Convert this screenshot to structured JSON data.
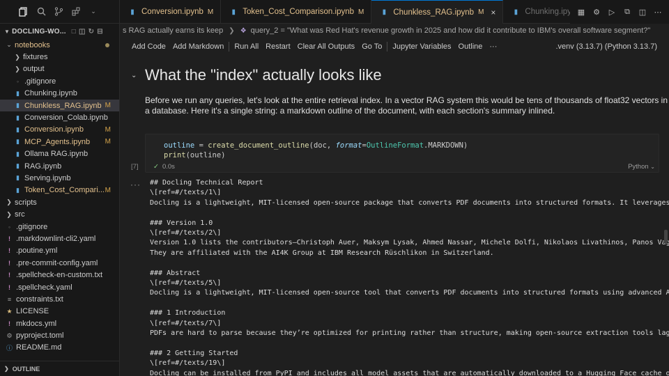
{
  "explorer": {
    "title": "DOCLING-WO...",
    "tree": [
      {
        "label": "notebooks",
        "kind": "folder-open",
        "color": "mod",
        "dot": true
      },
      {
        "label": "fixtures",
        "kind": "folder",
        "indent": 1
      },
      {
        "label": "output",
        "kind": "folder",
        "indent": 1
      },
      {
        "label": ".gitignore",
        "kind": "file",
        "indent": 1
      },
      {
        "label": "Chunking.ipynb",
        "kind": "notebook",
        "indent": 1
      },
      {
        "label": "Chunkless_RAG.ipynb",
        "kind": "notebook",
        "indent": 1,
        "status": "M",
        "selected": true,
        "color": "mod"
      },
      {
        "label": "Conversion_Colab.ipynb",
        "kind": "notebook",
        "indent": 1
      },
      {
        "label": "Conversion.ipynb",
        "kind": "notebook",
        "indent": 1,
        "status": "M",
        "color": "mod"
      },
      {
        "label": "MCP_Agents.ipynb",
        "kind": "notebook",
        "indent": 1,
        "status": "M",
        "color": "mod"
      },
      {
        "label": "Ollama RAG.ipynb",
        "kind": "notebook",
        "indent": 1
      },
      {
        "label": "RAG.ipynb",
        "kind": "notebook",
        "indent": 1
      },
      {
        "label": "Serving.ipynb",
        "kind": "notebook",
        "indent": 1
      },
      {
        "label": "Token_Cost_Compari...",
        "kind": "notebook",
        "indent": 1,
        "status": "M",
        "color": "mod"
      },
      {
        "label": "scripts",
        "kind": "folder",
        "indent": 0
      },
      {
        "label": "src",
        "kind": "folder",
        "indent": 0
      },
      {
        "label": ".gitignore",
        "kind": "file",
        "indent": 0
      },
      {
        "label": ".markdownlint-cli2.yaml",
        "kind": "yaml",
        "indent": 0
      },
      {
        "label": ".poutine.yml",
        "kind": "yaml",
        "indent": 0
      },
      {
        "label": ".pre-commit-config.yaml",
        "kind": "yaml",
        "indent": 0
      },
      {
        "label": ".spellcheck-en-custom.txt",
        "kind": "yaml",
        "indent": 0
      },
      {
        "label": ".spellcheck.yaml",
        "kind": "yaml",
        "indent": 0
      },
      {
        "label": "constraints.txt",
        "kind": "text",
        "indent": 0
      },
      {
        "label": "LICENSE",
        "kind": "license",
        "indent": 0
      },
      {
        "label": "mkdocs.yml",
        "kind": "yaml",
        "indent": 0
      },
      {
        "label": "pyproject.toml",
        "kind": "toml",
        "indent": 0
      },
      {
        "label": "README.md",
        "kind": "md",
        "indent": 0
      }
    ],
    "outline_label": "OUTLINE"
  },
  "tabs": [
    {
      "label": "Conversion.ipynb",
      "modified": "M"
    },
    {
      "label": "Token_Cost_Comparison.ipynb",
      "modified": "M"
    },
    {
      "label": "Chunkless_RAG.ipynb",
      "modified": "M",
      "active": true,
      "close": "×"
    },
    {
      "label": "Chunking.ipynb",
      "dim": true
    }
  ],
  "breadcrumb": {
    "part1": "s RAG actually earns its keep",
    "part2": "query_2 = \"What was Red Hat's revenue growth in 2025 and how did it contribute to IBM's overall software segment?\""
  },
  "toolbar": {
    "add_code": "Add Code",
    "add_markdown": "Add Markdown",
    "run_all": "Run All",
    "restart": "Restart",
    "clear_outputs": "Clear All Outputs",
    "go_to": "Go To",
    "jupyter_variables": "Jupyter Variables",
    "outline": "Outline",
    "more": "···",
    "kernel": ".venv (3.13.7) (Python 3.13.7)"
  },
  "cell_markdown": {
    "heading": "What the \"index\" actually looks like",
    "para_line1": "Before we run any queries, let's look at the entire retrieval index. In a vector RAG system this would be tens of thousands of float32 vectors in",
    "para_line2": "a database. Here it's a single string: a markdown outline of the document, with each section's summary inlined."
  },
  "cell_code": {
    "exec_count": "[7]",
    "exec_time": "0.0s",
    "language": "Python",
    "line1_var": "outline",
    "line1_eq": " = ",
    "line1_fn": "create_document_outline",
    "line1_arg": "(doc, ",
    "line1_param": "format",
    "line1_eq2": "=",
    "line1_cls": "OutlineFormat",
    "line1_end": ".MARKDOWN)",
    "line2_fn": "print",
    "line2_arg": "(outline)"
  },
  "output_text": "## Docling Technical Report\n\\[ref=#/texts/1\\]\nDocling is a lightweight, MIT-licensed open-source package that converts PDF documents into structured formats. It leverages st\n\n### Version 1.0\n\\[ref=#/texts/2\\]\nVersion 1.0 lists the contributors—Christoph Auer, Maksym Lysak, Ahmed Nassar, Michele Dolfi, Nikolaos Livathinos, Panos Vagena\nThey are affiliated with the AI4K Group at IBM Research Rüschlikon in Switzerland.\n\n### Abstract\n\\[ref=#/texts/5\\]\nDocling is a lightweight, MIT-licensed open-source tool that converts PDF documents into structured formats using advanced AI m\n\n### 1 Introduction\n\\[ref=#/texts/7\\]\nPDFs are hard to parse because they’re optimized for printing rather than structure, making open-source extraction tools lag be\n\n### 2 Getting Started\n\\[ref=#/texts/19\\]\nDocling can be installed from PyPI and includes all model assets that are automatically downloaded to a Hugging Face cache on f"
}
